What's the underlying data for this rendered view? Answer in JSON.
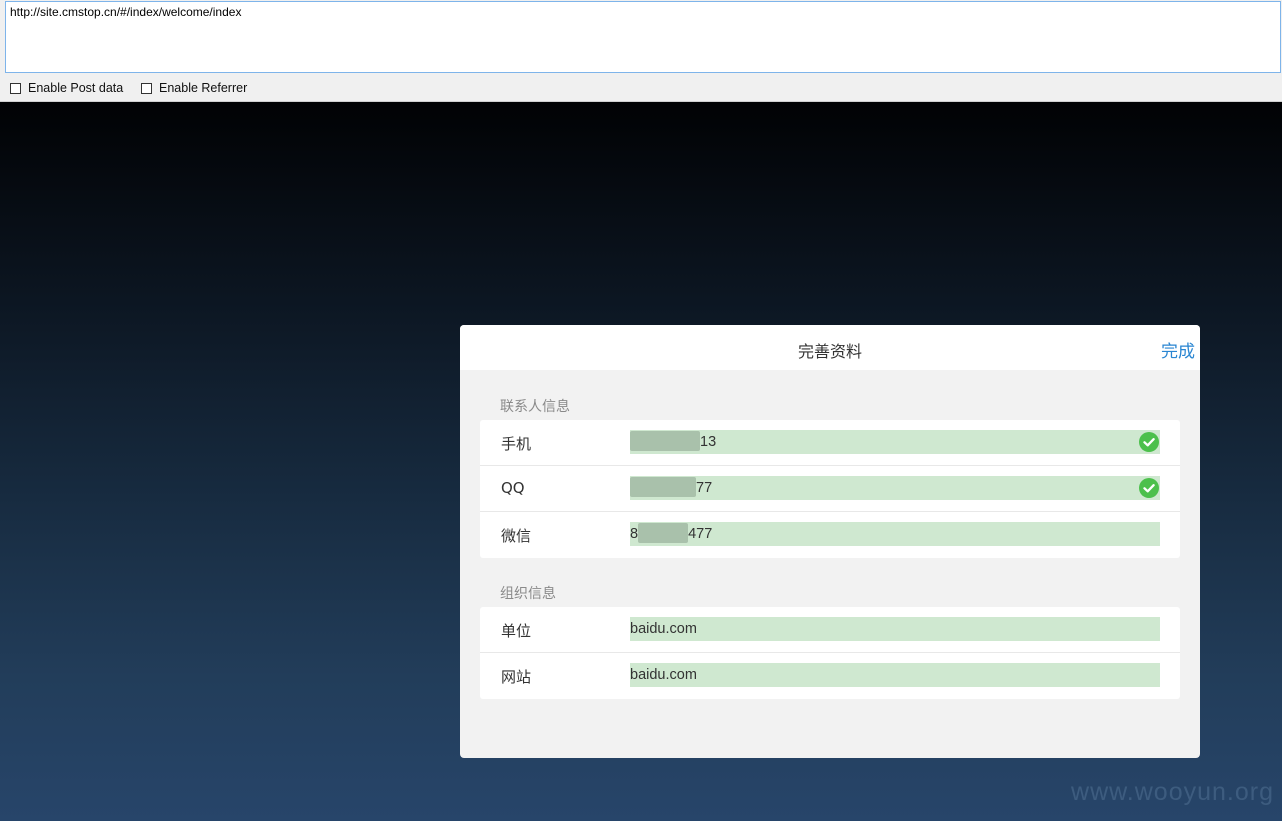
{
  "toolbar": {
    "url": "http://site.cmstop.cn/#/index/welcome/index",
    "enable_post_label": "Enable Post data",
    "enable_referrer_label": "Enable Referrer"
  },
  "dialog": {
    "title": "完善资料",
    "done_label": "完成",
    "contact_section": {
      "title": "联系人信息",
      "rows": [
        {
          "label": "手机",
          "value_suffix": "13",
          "verified": true
        },
        {
          "label": "QQ",
          "value_suffix": "77",
          "verified": true
        },
        {
          "label": "微信",
          "value_prefix": "8",
          "value_suffix": "477",
          "verified": false
        }
      ]
    },
    "org_section": {
      "title": "组织信息",
      "rows": [
        {
          "label": "单位",
          "value": "baidu.com"
        },
        {
          "label": "网站",
          "value": "baidu.com"
        }
      ]
    }
  },
  "watermark": "www.wooyun.org",
  "colors": {
    "accent": "#2a86d2",
    "field_fill": "#cfe8d0",
    "verified": "#4cc04c"
  },
  "icons": [
    "check-circle-icon"
  ]
}
